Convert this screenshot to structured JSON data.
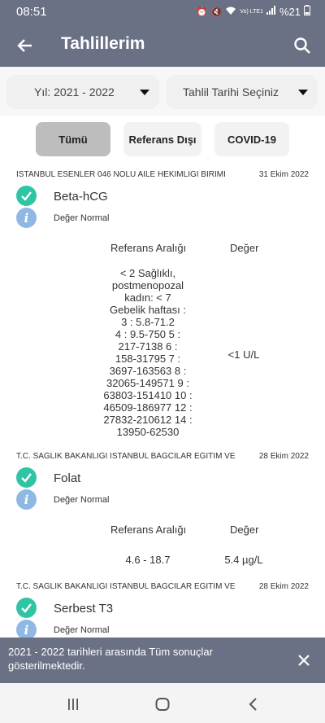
{
  "status_bar": {
    "time": "08:51",
    "network": "Vo) LTE1",
    "battery": "%21"
  },
  "app_bar": {
    "title": "Tahlillerim"
  },
  "filters": {
    "year": "Yıl: 2021 - 2022",
    "date": "Tahlil Tarihi Seçiniz"
  },
  "chips": {
    "all": "Tümü",
    "reference": "Referans Dışı",
    "covid": "COVID-19"
  },
  "labels": {
    "ref_range": "Referans Aralığı",
    "value": "Değer",
    "normal": "Değer Normal"
  },
  "results": [
    {
      "institution": "İSTANBUL ESENLER 046 NOLU AİLE HEKİMLİĞİ BİRİMİ",
      "date": "31 Ekim 2022",
      "test": "Beta-hCG",
      "ref_range": "< 2 Sağlıklı,\npostmenopozal\nkadın: < 7\nGebelik haftası :\n3 :   5.8-71.2\n4 :  9.5-750 5 :\n217-7138 6 :\n158-31795 7 :\n3697-163563 8 :\n32065-149571 9  :\n63803-151410 10 :\n46509-186977 12 :\n27832-210612 14 :\n13950-62530",
      "value": "<1 U/L"
    },
    {
      "institution": "T.C. SAĞLIK BAKANLIĞI İSTANBUL BAĞCILAR EĞİTİM VE",
      "date": "28 Ekim 2022",
      "test": "Folat",
      "ref_range": "4.6 - 18.7",
      "value": "5.4 µg/L"
    },
    {
      "institution": "T.C. SAĞLIK BAKANLIĞI İSTANBUL BAĞCILAR EĞİTİM VE",
      "date": "28 Ekim 2022",
      "test": "Serbest T3"
    }
  ],
  "snackbar": {
    "message": "2021 - 2022 tarihleri arasında Tüm sonuçlar gösterilmektedir."
  },
  "colors": {
    "primary": "#6b7185",
    "check": "#2ec4a4",
    "info": "#8fb8e4"
  }
}
